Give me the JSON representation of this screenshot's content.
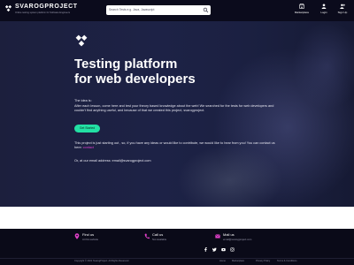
{
  "header": {
    "logo_name": "SVAROGPROJECT",
    "logo_tagline": "Online testing system platform for Software Engineers",
    "search_placeholder": "Search Tests e.g. Java, Javascript",
    "nav": [
      {
        "label": "Marketplace",
        "icon": "store-icon"
      },
      {
        "label": "Login",
        "icon": "user-icon"
      },
      {
        "label": "Sign Up",
        "icon": "add-user-icon"
      }
    ]
  },
  "hero": {
    "title_line1": "Testing platform",
    "title_line2": "for web developers",
    "idea_heading": "The idea is:",
    "idea_text": "After each lesson, come here and test your theory based knowledge about the web! We searched for the tests for web developers and couldn't find anything useful, and because of that we created this project, svarogproject.",
    "cta_label": "Get Started",
    "starting_text": "This project is just starting out , so, if you have any ideas or would like to contribute, we would like to hear from you! You can contact us here:",
    "contact_link": "contact",
    "email_text": "Or, at our email address: email@svarogproject.com"
  },
  "footer": {
    "items": [
      {
        "title": "Find us",
        "sub": "At this website",
        "icon": "location-pin-icon"
      },
      {
        "title": "Call us",
        "sub": "Not available",
        "icon": "phone-icon"
      },
      {
        "title": "Mail us",
        "sub": "email@svarogproject.com",
        "icon": "mail-icon"
      }
    ],
    "socials": [
      "facebook-icon",
      "twitter-icon",
      "youtube-icon",
      "instagram-icon"
    ],
    "copyright": "Copyright © 2021 SvarogProject. All Rights Reserved",
    "links": [
      "Home",
      "Marketplace",
      "Privacy Policy",
      "Terms & Conditions"
    ]
  },
  "colors": {
    "accent": "#23e0a4",
    "link": "#e040d0",
    "icon_pink": "#e040c8",
    "header_bg": "#0b0b1c",
    "hero_bg": "#1d2246"
  }
}
